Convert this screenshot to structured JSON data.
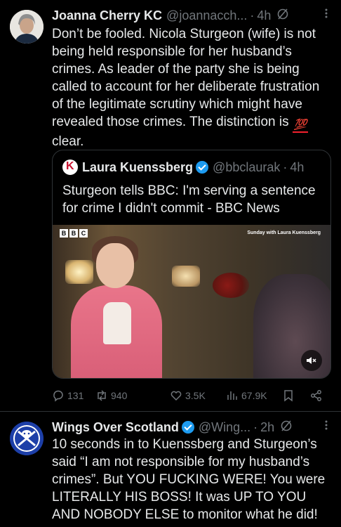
{
  "tweet1": {
    "author_name": "Joanna Cherry KC",
    "handle": "@joannacch...",
    "separator": "·",
    "time": "4h",
    "text_before_emoji": "Don’t be fooled. Nicola Sturgeon (wife) is not being held responsible for her husband’s crimes.  As leader of the  party she is being called to account for her deliberate frustration of the legitimate scrutiny which might have revealed those crimes. The distinction is ",
    "emoji": "💯",
    "text_after_emoji": " clear.",
    "quote": {
      "author_name": "Laura Kuenssberg",
      "handle": "@bbclaurak",
      "separator": "·",
      "time": "4h",
      "text": "Sturgeon tells BBC: I'm serving a sentence for crime I didn't commit - BBC News",
      "video": {
        "bbc_letters": [
          "B",
          "B",
          "C"
        ],
        "watermark": "Sunday with Laura Kuenssberg"
      }
    },
    "actions": {
      "replies": "131",
      "reposts": "940",
      "likes": "3.5K",
      "views": "67.9K"
    }
  },
  "tweet2": {
    "author_name": "Wings Over Scotland",
    "handle": "@Wing...",
    "separator": "·",
    "time": "2h",
    "text": "10 seconds in to Kuenssberg and Sturgeon’s said “I am not responsible for my husband’s crimes”. But YOU FUCKING WERE! You were LITERALLY HIS BOSS! It was UP TO YOU AND NOBODY ELSE to monitor what he did!"
  },
  "colors": {
    "background": "#000000",
    "text": "#e7e9ea",
    "secondary": "#71767b",
    "verified": "#1d9bf0",
    "border": "#2f3336"
  }
}
